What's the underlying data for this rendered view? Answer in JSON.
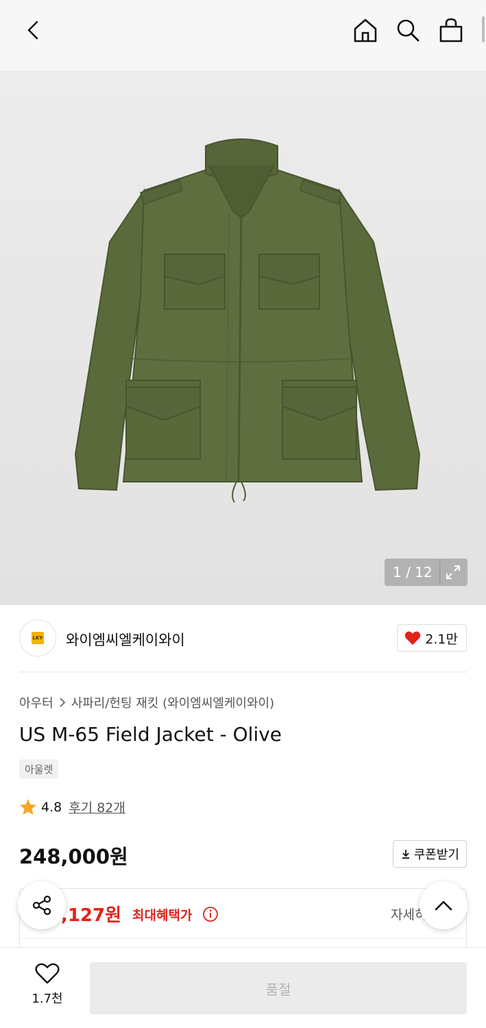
{
  "header": {
    "icons": [
      "back-icon",
      "home-icon",
      "search-icon",
      "shopping-bag-icon"
    ]
  },
  "gallery": {
    "pager": "1 / 12",
    "expand_icon": "expand-icon"
  },
  "brand": {
    "name": "와이엠씨엘케이와이",
    "logo_text": "LKY",
    "like_count": "2.1만",
    "like_color": "#e2231a"
  },
  "product": {
    "category_1": "아우터",
    "category_2": "사파리/헌팅 재킷 (와이엠씨엘케이와이)",
    "title": "US M-65 Field Jacket - Olive",
    "tag": "아울렛",
    "rating": "4.8",
    "reviews": "후기 82개",
    "price": "248,000원"
  },
  "coupon": {
    "label": "쿠폰받기"
  },
  "benefit": {
    "price": ",127원",
    "label": "최대혜택가",
    "detail": "자세히"
  },
  "bottom": {
    "wish_count": "1.7천",
    "buy_label": "품절"
  },
  "colors": {
    "accent_red": "#e2231a",
    "star": "#f5a623",
    "jacket_olive": "#5c6a3c"
  }
}
